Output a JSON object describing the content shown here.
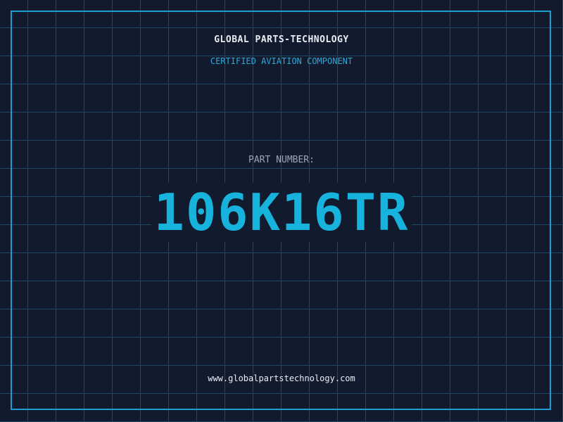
{
  "header": {
    "company": "GLOBAL PARTS-TECHNOLOGY",
    "subtitle": "CERTIFIED AVIATION COMPONENT"
  },
  "part": {
    "label": "PART NUMBER:",
    "number": "106K16TR"
  },
  "footer": {
    "website": "www.globalpartstechnology.com"
  },
  "colors": {
    "background": "#121a2e",
    "grid": "#1d4a62",
    "accent": "#17b3dc",
    "frame": "#1e9fcf"
  }
}
